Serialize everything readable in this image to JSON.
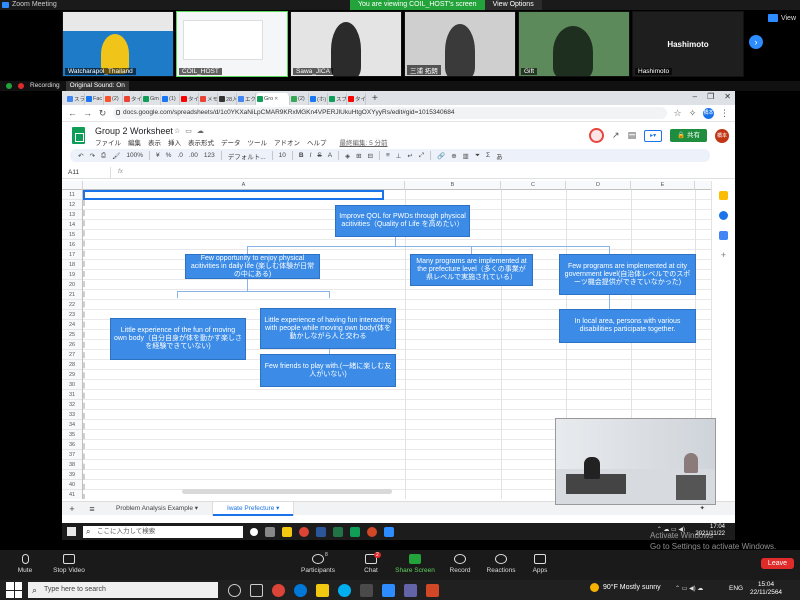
{
  "zoom": {
    "window_title": "Zoom Meeting",
    "viewing_banner": "You are viewing COIL_HOST's screen",
    "view_options": "View Options",
    "view_label": "View",
    "participants_tiles": [
      {
        "name": "Watcharapol_Thailand"
      },
      {
        "name": "COIL_HOST"
      },
      {
        "name": "Sawa_JICA"
      },
      {
        "name": "三浦 拓朗"
      },
      {
        "name": "Gift"
      },
      {
        "name": "Hashimoto",
        "big_name": "Hashimoto"
      }
    ],
    "recording": "Recording",
    "original_sound": "Original Sound: On",
    "controls": {
      "mute": "Mute",
      "stop_video": "Stop Video",
      "participants": "Participants",
      "participants_count": "8",
      "chat": "Chat",
      "chat_badge": "2",
      "share_screen": "Share Screen",
      "record": "Record",
      "reactions": "Reactions",
      "apps": "Apps",
      "leave": "Leave"
    }
  },
  "browser": {
    "tabs": [
      {
        "label": "スラ",
        "color": "#4285f4"
      },
      {
        "label": "Fac",
        "color": "#1877f2"
      },
      {
        "label": "(2)",
        "color": "#fb542b"
      },
      {
        "label": "タイ",
        "color": "#ea4335"
      },
      {
        "label": "Gm",
        "color": "#0f9d58"
      },
      {
        "label": "(1)",
        "color": "#1877f2"
      },
      {
        "label": "タイ",
        "color": "#ff0000"
      },
      {
        "label": "メモ",
        "color": "#ea4335"
      },
      {
        "label": "28入",
        "color": "#333333"
      },
      {
        "label": "エク",
        "color": "#4285f4"
      },
      {
        "label": "Gro",
        "color": "#0f9d58",
        "active": true
      },
      {
        "label": "(2)",
        "color": "#34a853"
      },
      {
        "label": "(ホ)",
        "color": "#1877f2"
      },
      {
        "label": "スプ",
        "color": "#0f9d58"
      },
      {
        "label": "タイ",
        "color": "#ff0000"
      }
    ],
    "url": "docs.google.com/spreadsheets/d/1c0YKXaNiLpCMAR9KRxMGKn4VPERJlUkuHtgOXYyyRs/edit#gid=1015340684",
    "profile_initial": "橋本"
  },
  "sheets": {
    "title": "Group 2 Worksheet",
    "menu": [
      "ファイル",
      "編集",
      "表示",
      "挿入",
      "表示形式",
      "データ",
      "ツール",
      "アドオン",
      "ヘルプ"
    ],
    "last_edit": "最終編集: 5 分前",
    "share_label": "共有",
    "user_initial": "橋本",
    "toolbar": {
      "zoom": "100%",
      "currency": "¥",
      "percent": "%",
      "decimals1": ".0",
      "decimals2": ".00",
      "format": "123",
      "font": "デフォルト...",
      "size": "10"
    },
    "cell_ref": "A11",
    "fx": "fx",
    "columns": [
      "A",
      "B",
      "C",
      "D",
      "E",
      "F",
      "G"
    ],
    "rows": [
      "11",
      "12",
      "13",
      "14",
      "15",
      "16",
      "17",
      "18",
      "19",
      "20",
      "21",
      "22",
      "23",
      "24",
      "25",
      "26",
      "27",
      "28",
      "29",
      "30",
      "31",
      "32",
      "33",
      "34",
      "35",
      "36",
      "37",
      "38",
      "39",
      "40",
      "41"
    ],
    "sheet_tabs": [
      "Problem Analysis Example",
      "Iwate Prefecture"
    ],
    "add_sheet": "+",
    "all_sheets": "≡"
  },
  "diagram": {
    "root": "Improve QOL for PWDs through physical acitivities（Quality of Life を高めたい）",
    "level1": [
      "Few opportunity to enjoy physical acitivities in daily life (楽しむ体験が日常の中にある)",
      "Many programs are implemented at the prefecture level（多くの事業が県レベルで実施されている）",
      "Few programs are implemented at city government level(自治体レベルでのスポーツ機会提供ができていなかった)"
    ],
    "level2": [
      "Little experience of the fun of moving own body（自分自身が体を動かす楽しさを経験できていない)",
      "Little experience of having fun interacting with people while moving own body(体を動かしながら人と交わる",
      "In local area, persons with various disabilities participate together."
    ],
    "level3": [
      "Few friends to play with.(一緒に楽しむ友人がいない)"
    ]
  },
  "inner_taskbar": {
    "search_placeholder": "ここに入力して検索",
    "time": "17:04",
    "date": "2021/11/22"
  },
  "activate_windows": {
    "line1": "Activate Windows",
    "line2": "Go to Settings to activate Windows."
  },
  "taskbar": {
    "search_placeholder": "Type here to search",
    "weather": "90°F  Mostly sunny",
    "lang": "ENG",
    "time": "15:04",
    "date": "22/11/2564"
  }
}
